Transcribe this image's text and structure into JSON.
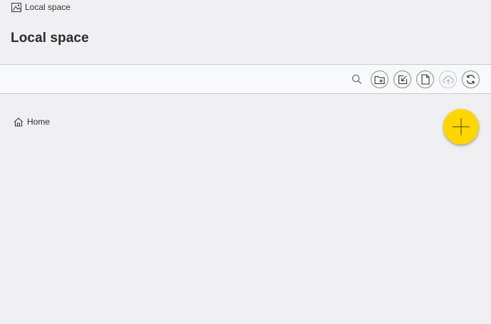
{
  "breadcrumb_top": {
    "label": "Local space",
    "icon": "local-space-icon"
  },
  "header": {
    "title": "Local space"
  },
  "toolbar": {
    "search_icon": "search-icon",
    "buttons": [
      {
        "name": "new-folder",
        "icon": "folder-plus-icon",
        "enabled": true
      },
      {
        "name": "import",
        "icon": "import-icon",
        "enabled": true
      },
      {
        "name": "new-file",
        "icon": "file-icon",
        "enabled": true
      },
      {
        "name": "upload",
        "icon": "cloud-upload-icon",
        "enabled": false
      },
      {
        "name": "sync",
        "icon": "sync-icon",
        "enabled": true
      }
    ]
  },
  "nav": {
    "home_label": "Home",
    "home_icon": "home-icon"
  },
  "fab": {
    "icon": "plus-icon",
    "color": "#ffd600"
  },
  "colors": {
    "background": "#f0f0f2",
    "toolbar": "#f8f9fa",
    "accent": "#ffd600"
  }
}
